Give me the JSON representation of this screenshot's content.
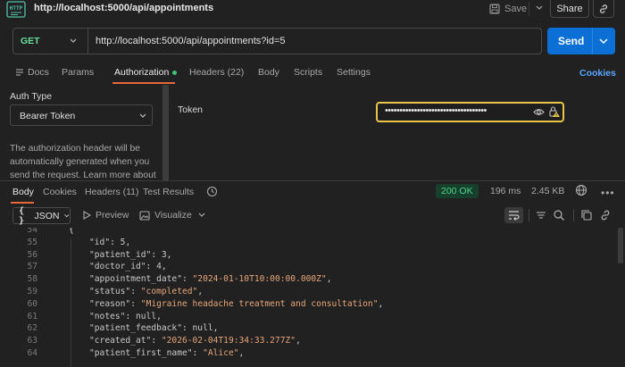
{
  "app": {
    "request_title": "http://localhost:5000/api/appointments",
    "save_label": "Save",
    "share_label": "Share"
  },
  "request": {
    "method": "GET",
    "url": "http://localhost:5000/api/appointments?id=5",
    "send_label": "Send",
    "tabs": [
      {
        "label": "Docs"
      },
      {
        "label": "Params"
      },
      {
        "label": "Authorization"
      },
      {
        "label": "Headers (22)"
      },
      {
        "label": "Body"
      },
      {
        "label": "Scripts"
      },
      {
        "label": "Settings"
      }
    ],
    "cookies_label": "Cookies"
  },
  "auth": {
    "type_label": "Auth Type",
    "type_value": "Bearer Token",
    "description": "The authorization header will be automatically generated when you send the request. Learn more about",
    "token_label": "Token",
    "token_masked": "•••••••••••••••••••••••••••••••••••"
  },
  "response": {
    "tabs": [
      {
        "label": "Body"
      },
      {
        "label": "Cookies"
      },
      {
        "label": "Headers (11)"
      },
      {
        "label": "Test Results"
      }
    ],
    "status": "200 OK",
    "time": "196 ms",
    "size": "2.45 KB",
    "format": "JSON",
    "preview_label": "Preview",
    "visualize_label": "Visualize",
    "accent_color": "#e8673a",
    "status_color": "#53d18a"
  },
  "code": {
    "lines": [
      {
        "n": "54",
        "text": "{"
      },
      {
        "n": "55",
        "key": "\"id\"",
        "val": "5",
        "kind": "num"
      },
      {
        "n": "56",
        "key": "\"patient_id\"",
        "val": "3",
        "kind": "num"
      },
      {
        "n": "57",
        "key": "\"doctor_id\"",
        "val": "4",
        "kind": "num"
      },
      {
        "n": "58",
        "key": "\"appointment_date\"",
        "val": "\"2024-01-10T10:00:00.000Z\"",
        "kind": "str"
      },
      {
        "n": "59",
        "key": "\"status\"",
        "val": "\"completed\"",
        "kind": "str"
      },
      {
        "n": "60",
        "key": "\"reason\"",
        "val": "\"Migraine headache treatment and consultation\"",
        "kind": "str"
      },
      {
        "n": "61",
        "key": "\"notes\"",
        "val": "null",
        "kind": "null"
      },
      {
        "n": "62",
        "key": "\"patient_feedback\"",
        "val": "null",
        "kind": "null"
      },
      {
        "n": "63",
        "key": "\"created_at\"",
        "val": "\"2026-02-04T19:34:33.277Z\"",
        "kind": "str"
      },
      {
        "n": "64",
        "key": "\"patient_first_name\"",
        "val": "\"Alice\"",
        "kind": "str"
      }
    ]
  }
}
